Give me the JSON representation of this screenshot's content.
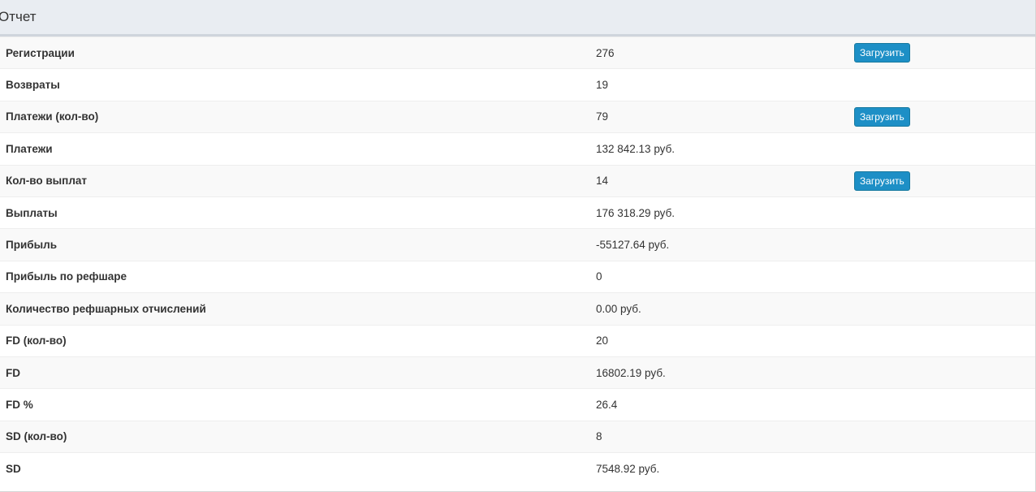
{
  "panel": {
    "title": "Отчет"
  },
  "rows": [
    {
      "label": "Регистрации",
      "value": "276",
      "button": "Загрузить"
    },
    {
      "label": "Возвраты",
      "value": "19"
    },
    {
      "label": "Платежи (кол-во)",
      "value": "79",
      "button": "Загрузить"
    },
    {
      "label": "Платежи",
      "value": "132 842.13 руб."
    },
    {
      "label": "Кол-во выплат",
      "value": "14",
      "button": "Загрузить"
    },
    {
      "label": "Выплаты",
      "value": "176 318.29 руб."
    },
    {
      "label": "Прибыль",
      "value": "-55127.64 руб."
    },
    {
      "label": "Прибыль по рефшаре",
      "value": "0"
    },
    {
      "label": "Количество рефшарных отчислений",
      "value": "0.00 руб."
    },
    {
      "label": "FD (кол-во)",
      "value": "20"
    },
    {
      "label": "FD",
      "value": "16802.19 руб."
    },
    {
      "label": "FD %",
      "value": "26.4"
    },
    {
      "label": "SD (кол-во)",
      "value": "8"
    },
    {
      "label": "SD",
      "value": "7548.92 руб."
    }
  ],
  "colors": {
    "button": "#1d8fc6",
    "heading_bg": "#e9edf2",
    "stripe": "#f9f9f9"
  }
}
